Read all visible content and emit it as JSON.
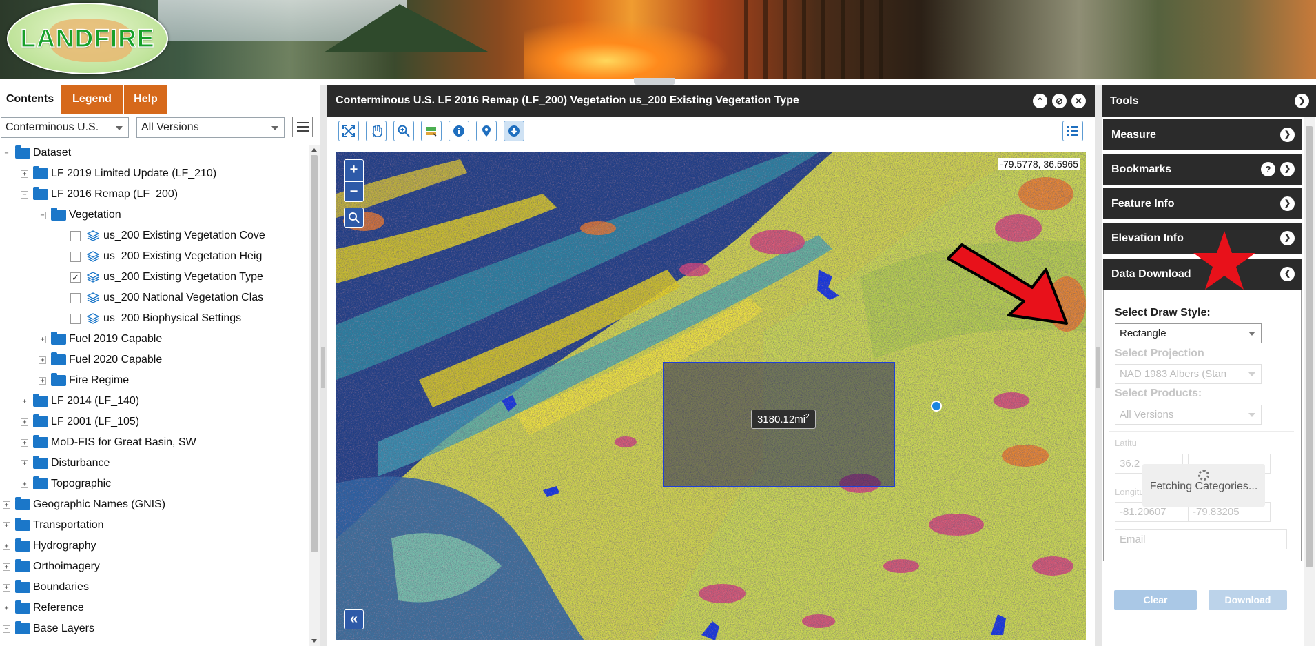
{
  "banner": {
    "logo_text": "LANDFIRE"
  },
  "left_panel": {
    "tabs": [
      {
        "label": "Contents",
        "active": true
      },
      {
        "label": "Legend",
        "active": false
      },
      {
        "label": "Help",
        "active": false
      }
    ],
    "region_select": "Conterminous U.S.",
    "version_select": "All Versions",
    "tree": [
      {
        "label": "Dataset",
        "level": 0,
        "type": "folder",
        "expander": "−"
      },
      {
        "label": "LF 2019 Limited Update (LF_210)",
        "level": 1,
        "type": "folder",
        "expander": "+"
      },
      {
        "label": "LF 2016 Remap (LF_200)",
        "level": 1,
        "type": "folder",
        "expander": "−"
      },
      {
        "label": "Vegetation",
        "level": 2,
        "type": "folder",
        "expander": "−"
      },
      {
        "label": "us_200 Existing Vegetation Cove",
        "level": 3,
        "type": "layer",
        "checked": false
      },
      {
        "label": "us_200 Existing Vegetation Heig",
        "level": 3,
        "type": "layer",
        "checked": false
      },
      {
        "label": "us_200 Existing Vegetation Type",
        "level": 3,
        "type": "layer",
        "checked": true
      },
      {
        "label": "us_200 National Vegetation Clas",
        "level": 3,
        "type": "layer",
        "checked": false
      },
      {
        "label": "us_200 Biophysical Settings",
        "level": 3,
        "type": "layer",
        "checked": false
      },
      {
        "label": "Fuel 2019 Capable",
        "level": 2,
        "type": "folder",
        "expander": "+"
      },
      {
        "label": "Fuel 2020 Capable",
        "level": 2,
        "type": "folder",
        "expander": "+"
      },
      {
        "label": "Fire Regime",
        "level": 2,
        "type": "folder",
        "expander": "+"
      },
      {
        "label": "LF 2014 (LF_140)",
        "level": 1,
        "type": "folder",
        "expander": "+"
      },
      {
        "label": "LF 2001 (LF_105)",
        "level": 1,
        "type": "folder",
        "expander": "+"
      },
      {
        "label": "MoD-FIS for Great Basin, SW",
        "level": 1,
        "type": "folder",
        "expander": "+"
      },
      {
        "label": "Disturbance",
        "level": 1,
        "type": "folder",
        "expander": "+"
      },
      {
        "label": "Topographic",
        "level": 1,
        "type": "folder",
        "expander": "+"
      },
      {
        "label": "Geographic Names (GNIS)",
        "level": 0,
        "type": "folder",
        "expander": "+"
      },
      {
        "label": "Transportation",
        "level": 0,
        "type": "folder",
        "expander": "+"
      },
      {
        "label": "Hydrography",
        "level": 0,
        "type": "folder",
        "expander": "+"
      },
      {
        "label": "Orthoimagery",
        "level": 0,
        "type": "folder",
        "expander": "+"
      },
      {
        "label": "Boundaries",
        "level": 0,
        "type": "folder",
        "expander": "+"
      },
      {
        "label": "Reference",
        "level": 0,
        "type": "folder",
        "expander": "+"
      },
      {
        "label": "Base Layers",
        "level": 0,
        "type": "folder",
        "expander": "−"
      }
    ]
  },
  "map_panel": {
    "title": "Conterminous U.S. LF 2016 Remap (LF_200) Vegetation us_200 Existing Vegetation Type",
    "toolbar_icons": [
      "full-extent-icon",
      "pan-icon",
      "zoom-in-icon",
      "layers-swap-icon",
      "info-icon",
      "pin-icon",
      "download-icon"
    ],
    "coordinates": "-79.5778, 36.5965",
    "zoom_in": "+",
    "zoom_out": "−",
    "collapse": "«",
    "area_measure": "3180.12mi",
    "area_unit_sup": "2"
  },
  "tools_panel": {
    "title": "Tools",
    "sections": [
      {
        "label": "Measure",
        "expanded": false
      },
      {
        "label": "Bookmarks",
        "expanded": false,
        "help": "?"
      },
      {
        "label": "Feature Info",
        "expanded": false
      },
      {
        "label": "Elevation Info",
        "expanded": false
      },
      {
        "label": "Data Download",
        "expanded": true
      }
    ],
    "download": {
      "draw_style_label": "Select Draw Style:",
      "draw_style_value": "Rectangle",
      "projection_label": "Select Projection",
      "projection_value": "NAD 1983 Albers (Stan",
      "products_label": "Select Products:",
      "products_value": "All Versions",
      "latitude_label": "Latitu",
      "latitude_value": "36.2",
      "longitude_label": "Longitude (dd):",
      "longitude_min": "-81.20607",
      "longitude_max": "-79.83205",
      "email_placeholder": "Email",
      "clear_label": "Clear",
      "download_label": "Download",
      "loading_text": "Fetching Categories..."
    }
  },
  "colors": {
    "accent_orange": "#d6691b",
    "header_dark": "#2b2b2b",
    "folder_blue": "#1b77c9",
    "annotation_red": "#e8111a",
    "draw_blue": "#1f3fd8"
  }
}
